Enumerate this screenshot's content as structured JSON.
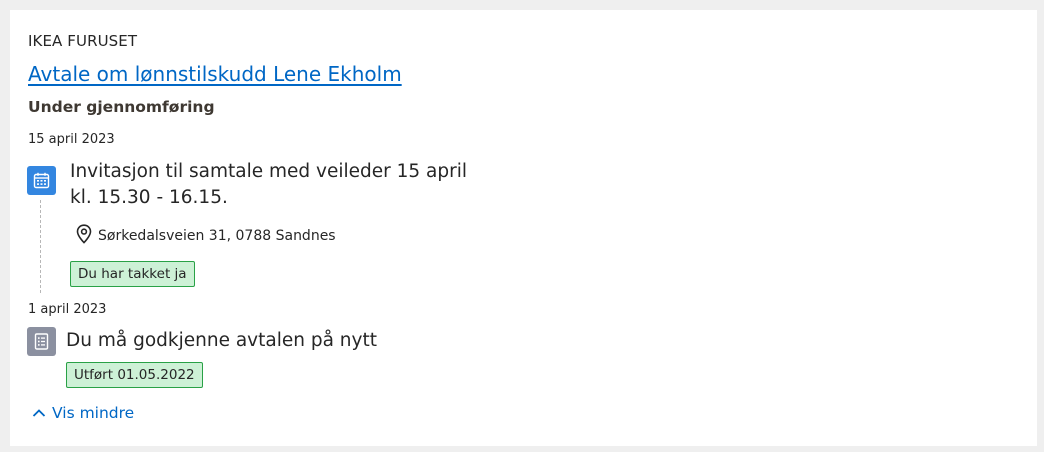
{
  "card": {
    "employer": "IKEA FURUSET",
    "title": "Avtale om lønnstilskudd Lene Ekholm",
    "status": "Under gjennomføring"
  },
  "events": [
    {
      "date": "15 april 2023",
      "icon": "calendar-icon",
      "text_line1": "Invitasjon til samtale med veileder 15 april",
      "text_line2": "kl. 15.30 - 16.15.",
      "location": "Sørkedalsveien 31, 0788 Sandnes",
      "tag": "Du har takket ja"
    },
    {
      "date": "1 april 2023",
      "icon": "document-icon",
      "text": "Du må godkjenne avtalen på nytt",
      "tag": "Utført 01.05.2022"
    }
  ],
  "toggle": {
    "label": "Vis mindre",
    "icon": "chevron-up-icon"
  },
  "colors": {
    "link": "#0067c5",
    "calendar_icon_bg": "#3386e0",
    "document_icon_bg": "#8b90a0",
    "tag_bg": "#cdf1d6",
    "tag_border": "#29a146"
  }
}
